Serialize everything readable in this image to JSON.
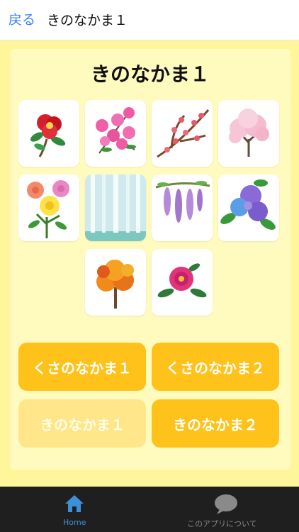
{
  "nav": {
    "back_label": "戻る",
    "title": "きのなかま１"
  },
  "main": {
    "heading": "きのなかま１",
    "tiles": [
      {
        "name": "camellia"
      },
      {
        "name": "azalea"
      },
      {
        "name": "plum-blossom"
      },
      {
        "name": "cherry-blossom-tree"
      },
      {
        "name": "roses"
      },
      {
        "name": "birch-forest"
      },
      {
        "name": "wisteria"
      },
      {
        "name": "hydrangea"
      },
      {
        "name": "autumn-maple-tree"
      },
      {
        "name": "peony"
      }
    ],
    "buttons": [
      {
        "label": "くさのなかま１",
        "active": true
      },
      {
        "label": "くさのなかま２",
        "active": true
      },
      {
        "label": "きのなかま１",
        "active": false
      },
      {
        "label": "きのなかま２",
        "active": true
      }
    ]
  },
  "tabbar": {
    "tabs": [
      {
        "label": "Home",
        "icon": "home-icon",
        "selected": true
      },
      {
        "label": "このアプリについて",
        "icon": "speech-bubble-icon",
        "selected": false
      }
    ]
  },
  "colors": {
    "background": "#fff59a",
    "panel": "#fffbbf",
    "button": "#ffc21a",
    "button_disabled": "#ffe68a",
    "link": "#3b82f6",
    "tabbar": "#1f1f1f"
  }
}
